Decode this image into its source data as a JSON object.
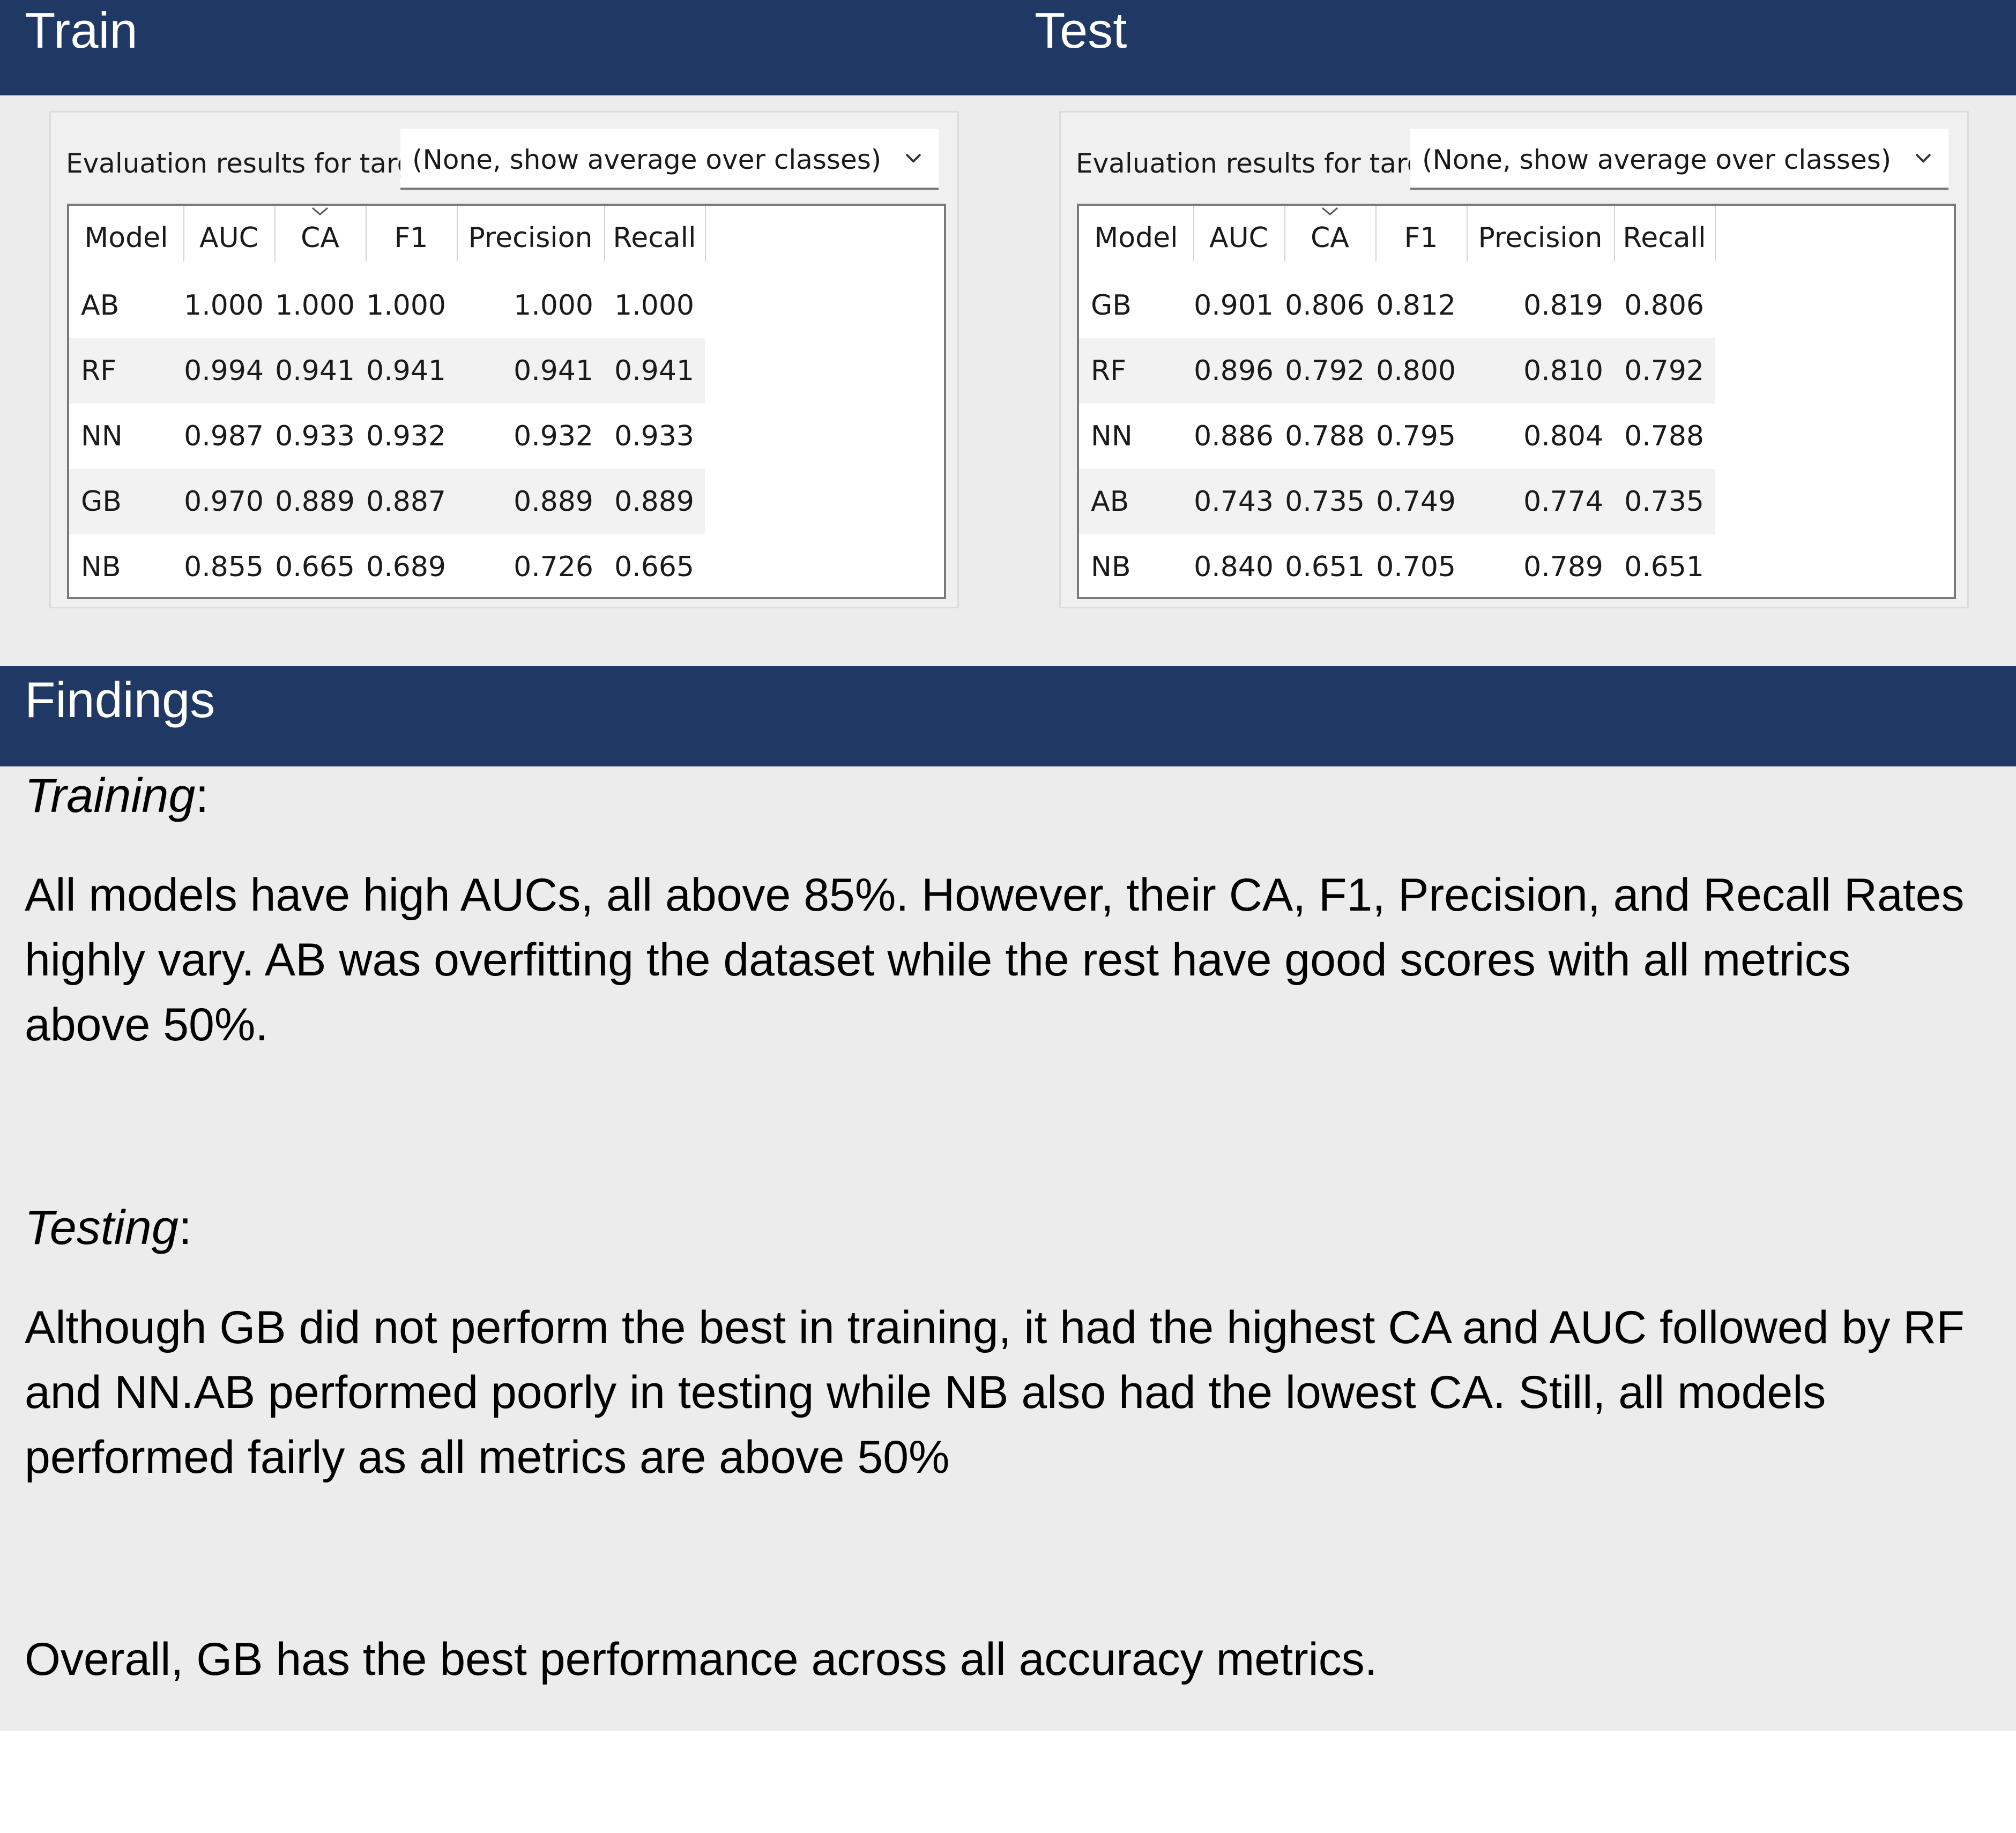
{
  "header": {
    "train_title": "Train",
    "test_title": "Test"
  },
  "train_panel": {
    "target_label": "Evaluation results for target",
    "target_value": "(None, show average over classes)",
    "columns": [
      "Model",
      "AUC",
      "CA",
      "F1",
      "Precision",
      "Recall"
    ],
    "rows": [
      [
        "AB",
        "1.000",
        "1.000",
        "1.000",
        "1.000",
        "1.000"
      ],
      [
        "RF",
        "0.994",
        "0.941",
        "0.941",
        "0.941",
        "0.941"
      ],
      [
        "NN",
        "0.987",
        "0.933",
        "0.932",
        "0.932",
        "0.933"
      ],
      [
        "GB",
        "0.970",
        "0.889",
        "0.887",
        "0.889",
        "0.889"
      ],
      [
        "NB",
        "0.855",
        "0.665",
        "0.689",
        "0.726",
        "0.665"
      ]
    ]
  },
  "test_panel": {
    "target_label": "Evaluation results for target",
    "target_value": "(None, show average over classes)",
    "columns": [
      "Model",
      "AUC",
      "CA",
      "F1",
      "Precision",
      "Recall"
    ],
    "rows": [
      [
        "GB",
        "0.901",
        "0.806",
        "0.812",
        "0.819",
        "0.806"
      ],
      [
        "RF",
        "0.896",
        "0.792",
        "0.800",
        "0.810",
        "0.792"
      ],
      [
        "NN",
        "0.886",
        "0.788",
        "0.795",
        "0.804",
        "0.788"
      ],
      [
        "AB",
        "0.743",
        "0.735",
        "0.749",
        "0.774",
        "0.735"
      ],
      [
        "NB",
        "0.840",
        "0.651",
        "0.705",
        "0.789",
        "0.651"
      ]
    ]
  },
  "findings": {
    "title": "Findings",
    "training_heading": "Training",
    "training_colon": ":",
    "training_text": "All models have high AUCs, all above 85%. However, their CA, F1, Precision, and Recall Rates highly vary. AB was overfitting the dataset while the rest have good scores with all metrics above 50%.",
    "testing_heading": "Testing",
    "testing_colon": ":",
    "testing_text": "Although GB did not perform the best in training, it had the highest CA and AUC followed by RF and NN.AB performed poorly in testing while NB also had the lowest CA. Still, all models performed fairly as all metrics are above 50%",
    "overall_text": "Overall, GB has the best performance across all accuracy metrics."
  },
  "colors": {
    "header_bg": "#203864",
    "band_bg": "#ececec"
  },
  "icons": {
    "dropdown": "chevron-down-icon",
    "sort": "sort-caret-icon"
  }
}
